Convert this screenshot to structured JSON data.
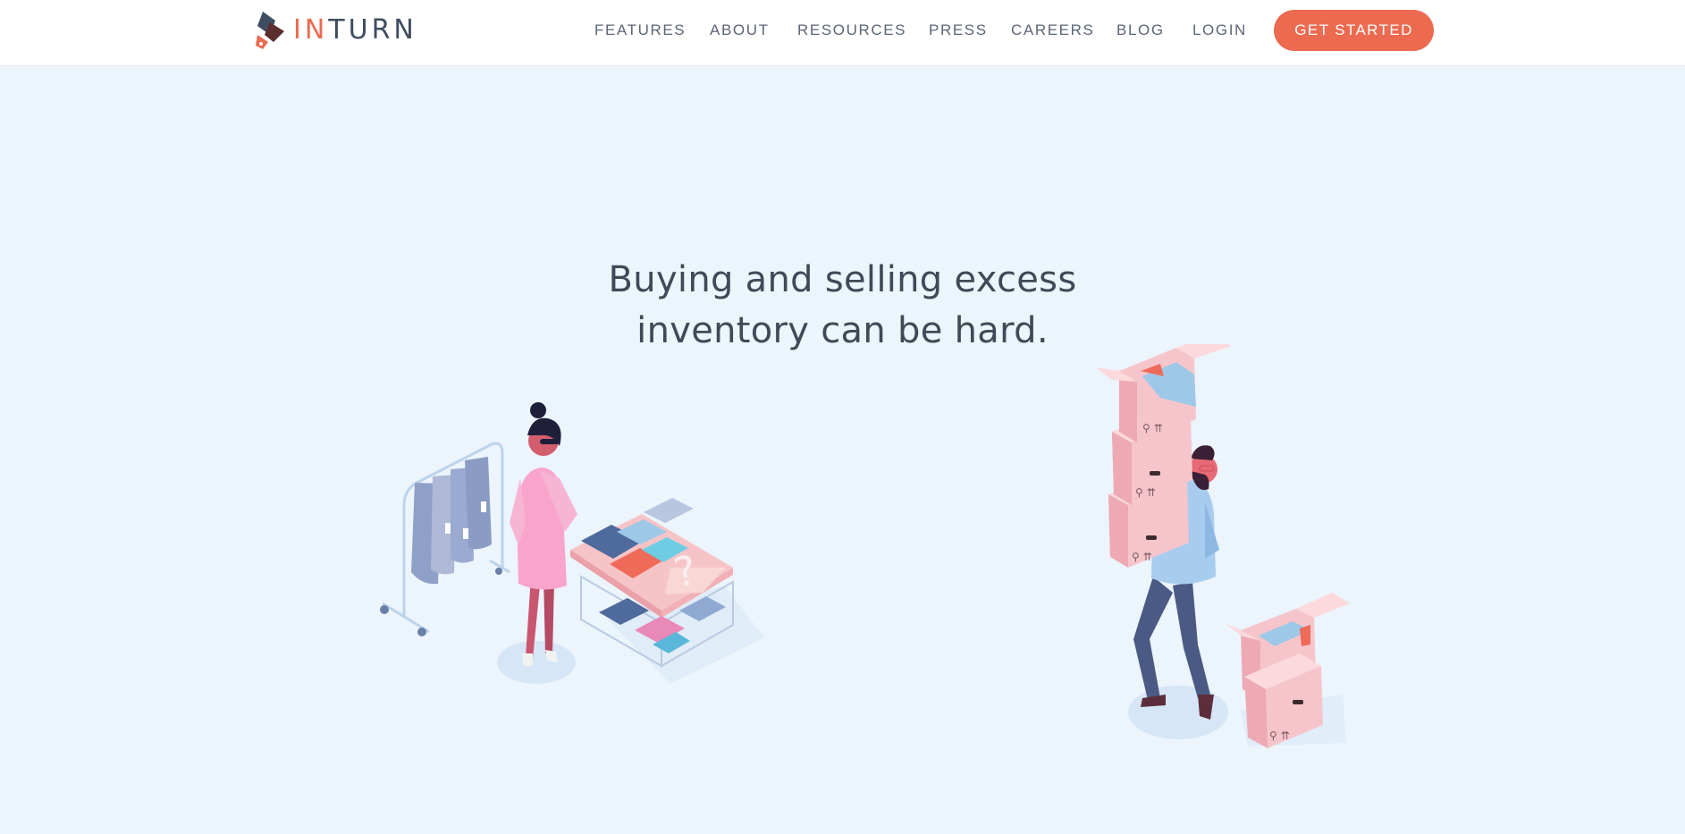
{
  "brand": {
    "name_part1": "IN",
    "name_part2": "TURN",
    "colors": {
      "accent": "#ec6a4f",
      "dark": "#3f4d60",
      "background": "#ecf4fc"
    }
  },
  "nav": {
    "links": [
      {
        "label": "FEATURES"
      },
      {
        "label": "ABOUT"
      },
      {
        "label": "RESOURCES"
      },
      {
        "label": "PRESS"
      },
      {
        "label": "CAREERS"
      },
      {
        "label": "BLOG"
      },
      {
        "label": "LOGIN"
      }
    ],
    "cta_label": "GET STARTED"
  },
  "hero": {
    "headline_line1": "Buying and selling excess",
    "headline_line2": "inventory can be hard.",
    "illustrations": {
      "left": "woman-shopping-clothing-illustration",
      "right": "man-carrying-boxes-illustration"
    }
  }
}
